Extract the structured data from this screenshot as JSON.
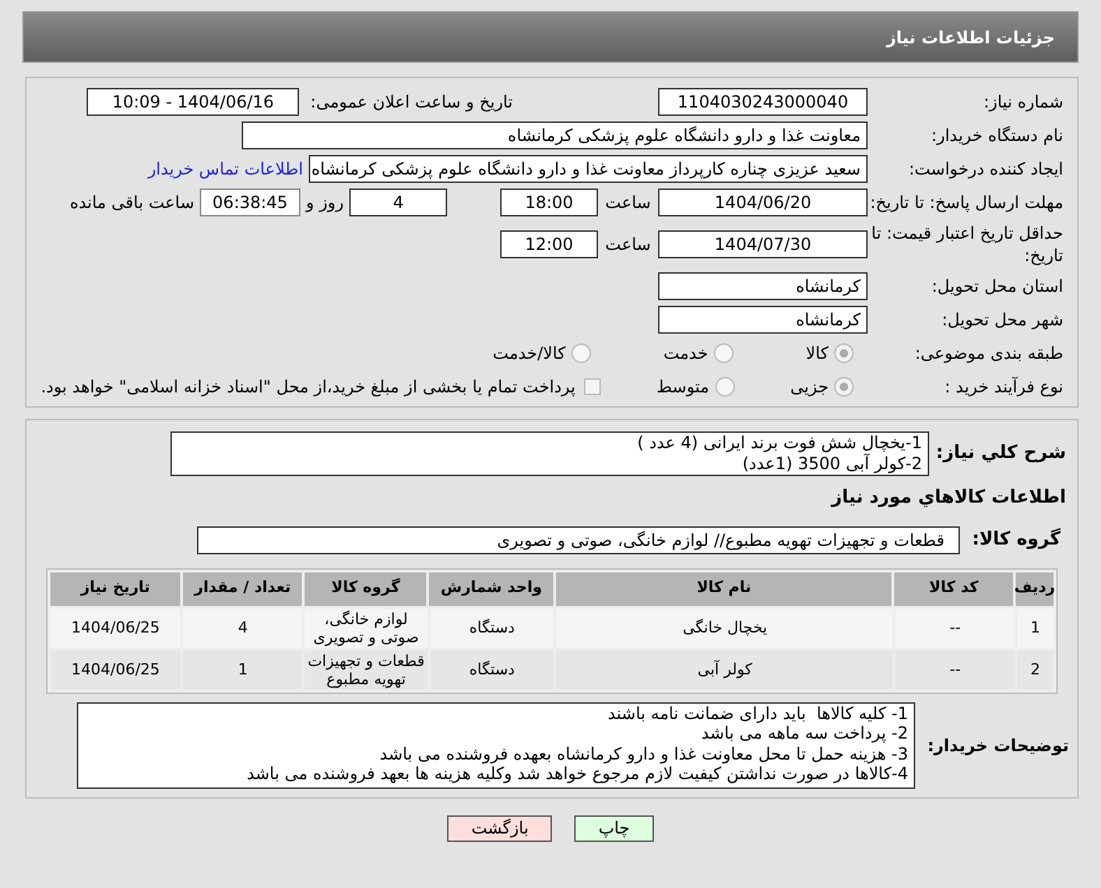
{
  "header": {
    "title": "جزئیات اطلاعات نیاز"
  },
  "need_number": {
    "label": "شماره نیاز:",
    "value": "1104030243000040"
  },
  "announce": {
    "label": "تاریخ و ساعت اعلان عمومی:",
    "value": "1404/06/16 - 10:09"
  },
  "buyer_org": {
    "label": "نام دستگاه خریدار:",
    "value": "معاونت غذا و دارو دانشگاه علوم پزشکی کرمانشاه"
  },
  "requester": {
    "label": "ایجاد کننده درخواست:",
    "value": "سعید عزیزی چناره کارپرداز معاونت غذا و دارو دانشگاه علوم پزشکی کرمانشاه",
    "link": "اطلاعات تماس خریدار"
  },
  "reply_deadline": {
    "label": "مهلت ارسال پاسخ: تا تاریخ:",
    "date": "1404/06/20",
    "time_label": "ساعت",
    "time": "18:00",
    "days": "4",
    "days_label": "روز و",
    "remaining": "06:38:45",
    "remaining_label": "ساعت باقی مانده"
  },
  "price_validity": {
    "label": "حداقل تاریخ اعتبار قیمت: تا تاریخ:",
    "date": "1404/07/30",
    "time_label": "ساعت",
    "time": "12:00"
  },
  "province": {
    "label": "استان محل تحویل:",
    "value": "کرمانشاه"
  },
  "city": {
    "label": "شهر محل تحویل:",
    "value": "کرمانشاه"
  },
  "category": {
    "label": "طبقه بندی موضوعی:",
    "options": [
      {
        "label": "کالا",
        "selected": true
      },
      {
        "label": "خدمت",
        "selected": false
      },
      {
        "label": "کالا/خدمت",
        "selected": false
      }
    ]
  },
  "purchase_type": {
    "label": "نوع فرآیند خرید :",
    "options": [
      {
        "label": "جزیی",
        "selected": true
      },
      {
        "label": "متوسط",
        "selected": false
      }
    ],
    "treasury": {
      "checked": false,
      "label": "پرداخت تمام یا بخشی از مبلغ خرید،از محل \"اسناد خزانه اسلامی\" خواهد بود."
    }
  },
  "description": {
    "label": "شرح کلي نياز:",
    "lines": [
      "1-یخچال شش فوت برند ایرانی (4 عدد )",
      "2-کولر آبی 3500 (1عدد)"
    ]
  },
  "goods_heading": "اطلاعات کالاهاي مورد نياز",
  "goods_group": {
    "label": "گروه کالا:",
    "value": "قطعات و تجهیزات تهویه مطبوع// لوازم خانگی، صوتی و تصویری"
  },
  "table": {
    "columns": [
      "ردیف",
      "کد کالا",
      "نام کالا",
      "واحد شمارش",
      "گروه کالا",
      "تعداد / مقدار",
      "تاریخ نیاز"
    ],
    "rows": [
      [
        "1",
        "--",
        "یخچال خانگی",
        "دستگاه",
        "لوازم خانگی، صوتی و تصویری",
        "4",
        "1404/06/25"
      ],
      [
        "2",
        "--",
        "کولر آبی",
        "دستگاه",
        "قطعات و تجهیزات تهویه مطبوع",
        "1",
        "1404/06/25"
      ]
    ]
  },
  "buyer_notes": {
    "label": "توضیحات خریدار:",
    "lines": [
      "1- کلیه کالاها  باید دارای ضمانت نامه باشند",
      "2- پرداخت سه ماهه می باشد",
      "3- هزینه حمل تا محل معاونت غذا و دارو کرمانشاه بعهده فروشنده می باشد",
      "4-کالاها در صورت نداشتن کیفیت لازم مرجوع خواهد شد وکلیه هزینه ها بعهد فروشنده می باشد"
    ]
  },
  "buttons": [
    {
      "label": "چاپ",
      "kind": "print"
    },
    {
      "label": "بازگشت",
      "kind": "back"
    }
  ]
}
